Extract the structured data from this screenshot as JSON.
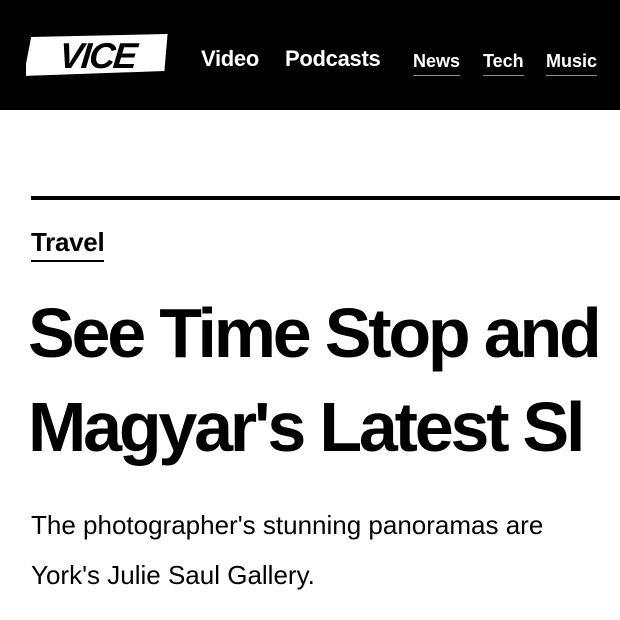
{
  "header": {
    "logo_text": "VICE",
    "background": "#000000",
    "nav_primary": [
      "Video",
      "Podcasts"
    ],
    "nav_secondary": [
      "News",
      "Tech",
      "Music"
    ]
  },
  "article": {
    "category": "Travel",
    "headline_lines": [
      "See Time Stop and",
      "Magyar's Latest Sl"
    ],
    "dek_lines": [
      "The photographer's stunning panoramas are",
      "York's Julie Saul Gallery."
    ]
  }
}
